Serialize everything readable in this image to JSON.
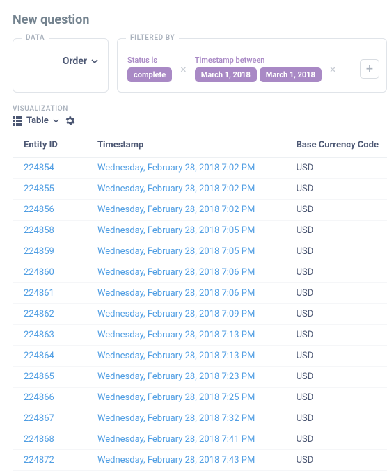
{
  "title": "New question",
  "data_section": {
    "label": "DATA",
    "source": "Order"
  },
  "filter_section": {
    "label": "FILTERED BY",
    "filters": [
      {
        "caption": "Status is",
        "pills": [
          "complete"
        ]
      },
      {
        "caption": "Timestamp between",
        "pills": [
          "March 1, 2018",
          "March 1, 2018"
        ]
      }
    ]
  },
  "viz_section": {
    "label": "VISUALIZATION",
    "type": "Table"
  },
  "table": {
    "columns": [
      "Entity ID",
      "Timestamp",
      "Base Currency Code"
    ],
    "rows": [
      {
        "entity_id": "224854",
        "timestamp": "Wednesday, February 28, 2018 7:02 PM",
        "currency": "USD"
      },
      {
        "entity_id": "224855",
        "timestamp": "Wednesday, February 28, 2018 7:02 PM",
        "currency": "USD"
      },
      {
        "entity_id": "224856",
        "timestamp": "Wednesday, February 28, 2018 7:02 PM",
        "currency": "USD"
      },
      {
        "entity_id": "224858",
        "timestamp": "Wednesday, February 28, 2018 7:05 PM",
        "currency": "USD"
      },
      {
        "entity_id": "224859",
        "timestamp": "Wednesday, February 28, 2018 7:05 PM",
        "currency": "USD"
      },
      {
        "entity_id": "224860",
        "timestamp": "Wednesday, February 28, 2018 7:06 PM",
        "currency": "USD"
      },
      {
        "entity_id": "224861",
        "timestamp": "Wednesday, February 28, 2018 7:06 PM",
        "currency": "USD"
      },
      {
        "entity_id": "224862",
        "timestamp": "Wednesday, February 28, 2018 7:09 PM",
        "currency": "USD"
      },
      {
        "entity_id": "224863",
        "timestamp": "Wednesday, February 28, 2018 7:13 PM",
        "currency": "USD"
      },
      {
        "entity_id": "224864",
        "timestamp": "Wednesday, February 28, 2018 7:13 PM",
        "currency": "USD"
      },
      {
        "entity_id": "224865",
        "timestamp": "Wednesday, February 28, 2018 7:23 PM",
        "currency": "USD"
      },
      {
        "entity_id": "224866",
        "timestamp": "Wednesday, February 28, 2018 7:25 PM",
        "currency": "USD"
      },
      {
        "entity_id": "224867",
        "timestamp": "Wednesday, February 28, 2018 7:32 PM",
        "currency": "USD"
      },
      {
        "entity_id": "224868",
        "timestamp": "Wednesday, February 28, 2018 7:41 PM",
        "currency": "USD"
      },
      {
        "entity_id": "224872",
        "timestamp": "Wednesday, February 28, 2018 7:43 PM",
        "currency": "USD"
      }
    ]
  }
}
